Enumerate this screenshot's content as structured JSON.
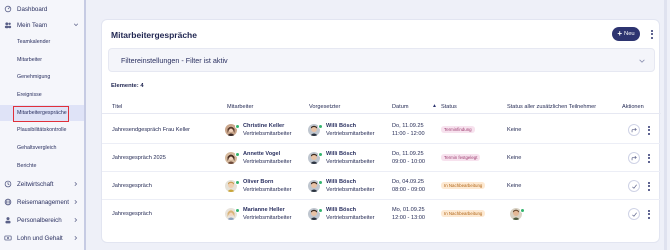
{
  "sidebar": {
    "items": [
      {
        "label": "Dashboard",
        "icon": "dashboard-icon"
      },
      {
        "label": "Mein Team",
        "icon": "team-icon"
      },
      {
        "label": "Zeitwirtschaft",
        "icon": "clock-icon"
      },
      {
        "label": "Reisemanagement",
        "icon": "globe-icon"
      },
      {
        "label": "Personalbereich",
        "icon": "person-icon"
      },
      {
        "label": "Lohn und Gehalt",
        "icon": "money-icon"
      }
    ],
    "subitems": [
      {
        "label": "Teamkalender"
      },
      {
        "label": "Mitarbeiter"
      },
      {
        "label": "Genehmigung"
      },
      {
        "label": "Ereignisse"
      },
      {
        "label": "Mitarbeitergespräche"
      },
      {
        "label": "Plausibilitätskontrolle"
      },
      {
        "label": "Gehaltsvergleich"
      },
      {
        "label": "Berichte"
      }
    ]
  },
  "main": {
    "title": "Mitarbeitergespräche",
    "new_button": "Neu",
    "filter_label": "Filtereinstellungen - Filter ist aktiv",
    "elements_label": "Elemente: 4",
    "columns": [
      "Titel",
      "Mitarbeiter",
      "Vorgesetzter",
      "Datum",
      "Status",
      "Status aller zusätzlichen Teilnehmer",
      "Aktionen"
    ],
    "rows": [
      {
        "title": "Jahresendgespräch Frau Keller",
        "employee_name": "Christine Keller",
        "employee_role": "Vertriebsmitarbeiter",
        "manager_name": "Willi Bösch",
        "manager_role": "Vertriebsmitarbeiter",
        "date": "Do, 11.09.25",
        "time": "11:00 - 12:00",
        "status": "Terminfindung",
        "participants_status": "Keine",
        "action_icon": "share-icon"
      },
      {
        "title": "Jahresgespräch 2025",
        "employee_name": "Annette Vogel",
        "employee_role": "Vertriebsmitarbeiter",
        "manager_name": "Willi Bösch",
        "manager_role": "Vertriebsmitarbeiter",
        "date": "Do, 11.09.25",
        "time": "09:00 - 10:00",
        "status": "Termin festgelegt",
        "participants_status": "Keine",
        "action_icon": "share-icon"
      },
      {
        "title": "Jahresgespräch",
        "employee_name": "Oliver Born",
        "employee_role": "Vertriebsmitarbeiter",
        "manager_name": "Willi Bösch",
        "manager_role": "Vertriebsmitarbeiter",
        "date": "Do, 04.09.25",
        "time": "08:00 - 09:00",
        "status": "In Nachbearbeitung",
        "participants_status": "Keine",
        "action_icon": "check-icon"
      },
      {
        "title": "Jahresgespräch",
        "employee_name": "Marianne Heller",
        "employee_role": "Vertriebsmitarbeiter",
        "manager_name": "Willi Bösch",
        "manager_role": "Vertriebsmitarbeiter",
        "date": "Mo, 01.09.25",
        "time": "12:00 - 13:00",
        "status": "In Nachbearbeitung",
        "participants_status": "",
        "action_icon": "check-icon"
      }
    ]
  },
  "colors": {
    "accent": "#2d3470",
    "highlight_border": "#e0303a",
    "status_pink_bg": "#f7e2ee",
    "status_amber_bg": "#fde9d2",
    "online_badge": "#33b46d"
  }
}
